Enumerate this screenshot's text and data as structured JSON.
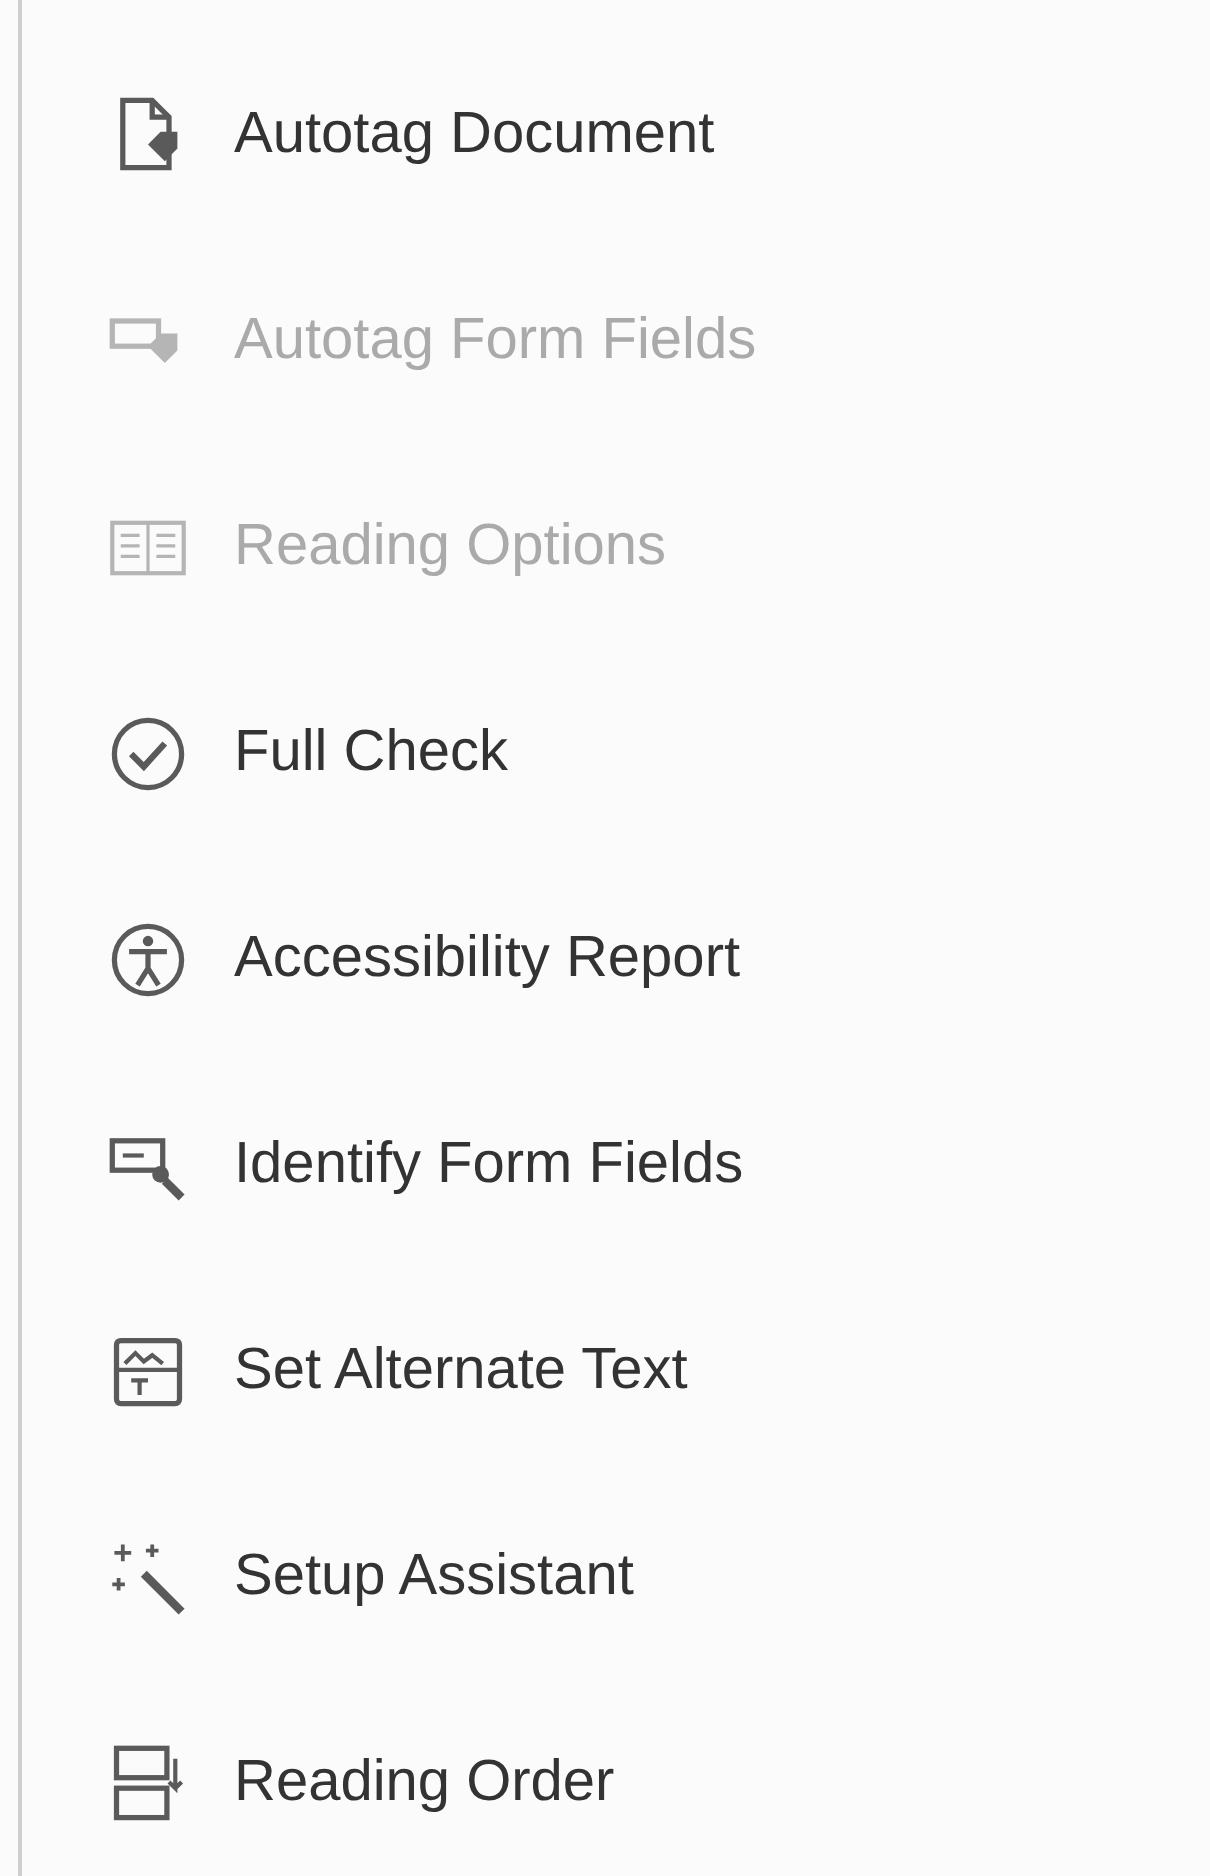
{
  "tools": [
    {
      "kind": "document",
      "label": "Autotag Document",
      "disabled": false
    },
    {
      "kind": "formtag",
      "label": "Autotag Form Fields",
      "disabled": true
    },
    {
      "kind": "reading",
      "label": "Reading Options",
      "disabled": true
    },
    {
      "kind": "check",
      "label": "Full Check",
      "disabled": false
    },
    {
      "kind": "accessibility",
      "label": "Accessibility Report",
      "disabled": false
    },
    {
      "kind": "identify",
      "label": "Identify Form Fields",
      "disabled": false
    },
    {
      "kind": "alttext",
      "label": "Set Alternate Text",
      "disabled": false
    },
    {
      "kind": "wand",
      "label": "Setup Assistant",
      "disabled": false
    },
    {
      "kind": "order",
      "label": "Reading Order",
      "disabled": false
    }
  ]
}
